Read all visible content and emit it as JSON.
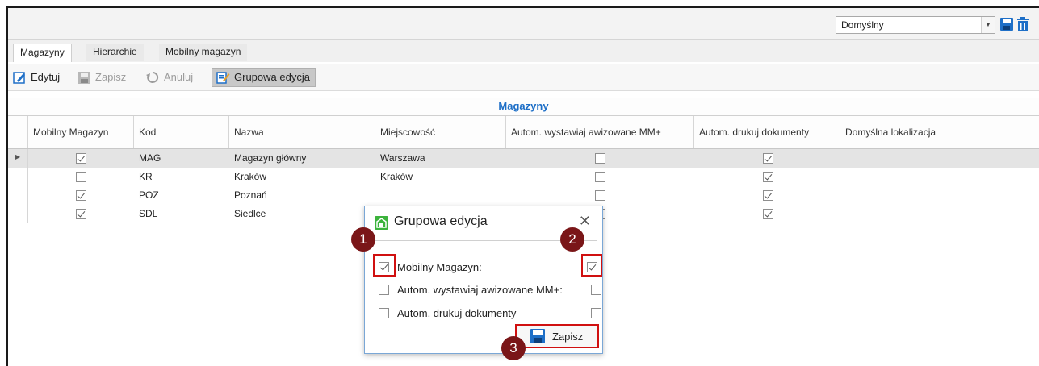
{
  "toolbar_top": {
    "layout_value": "Domyślny"
  },
  "tabs": [
    {
      "label": "Magazyny",
      "active": true
    },
    {
      "label": "Hierarchie",
      "active": false
    },
    {
      "label": "Mobilny magazyn",
      "active": false
    }
  ],
  "toolbar": {
    "edit_label": "Edytuj",
    "save_label": "Zapisz",
    "cancel_label": "Anuluj",
    "group_edit_label": "Grupowa edycja"
  },
  "grid": {
    "title": "Magazyny",
    "columns": [
      "Mobilny Magazyn",
      "Kod",
      "Nazwa",
      "Miejscowość",
      "Autom. wystawiaj awizowane MM+",
      "Autom. drukuj dokumenty",
      "Domyślna lokalizacja"
    ],
    "rows": [
      {
        "mobile": true,
        "code": "MAG",
        "name": "Magazyn główny",
        "city": "Warszawa",
        "auto_mm": false,
        "auto_print": true
      },
      {
        "mobile": false,
        "code": "KR",
        "name": "Kraków",
        "city": "Kraków",
        "auto_mm": false,
        "auto_print": true
      },
      {
        "mobile": true,
        "code": "POZ",
        "name": "Poznań",
        "city": "",
        "auto_mm": false,
        "auto_print": true
      },
      {
        "mobile": true,
        "code": "SDL",
        "name": "Siedlce",
        "city": "",
        "auto_mm": false,
        "auto_print": true
      }
    ]
  },
  "dialog": {
    "title": "Grupowa edycja",
    "close_glyph": "✕",
    "fields": [
      {
        "label": "Mobilny Magazyn:",
        "enabled": true,
        "value": true
      },
      {
        "label": "Autom. wystawiaj awizowane MM+:",
        "enabled": false,
        "value": false
      },
      {
        "label": "Autom. drukuj dokumenty",
        "enabled": false,
        "value": false
      }
    ],
    "save_label": "Zapisz"
  },
  "badges": [
    "1",
    "2",
    "3"
  ],
  "colors": {
    "grid_title": "#1e6fc7",
    "highlight": "#d01010",
    "badge": "#7a1618"
  }
}
